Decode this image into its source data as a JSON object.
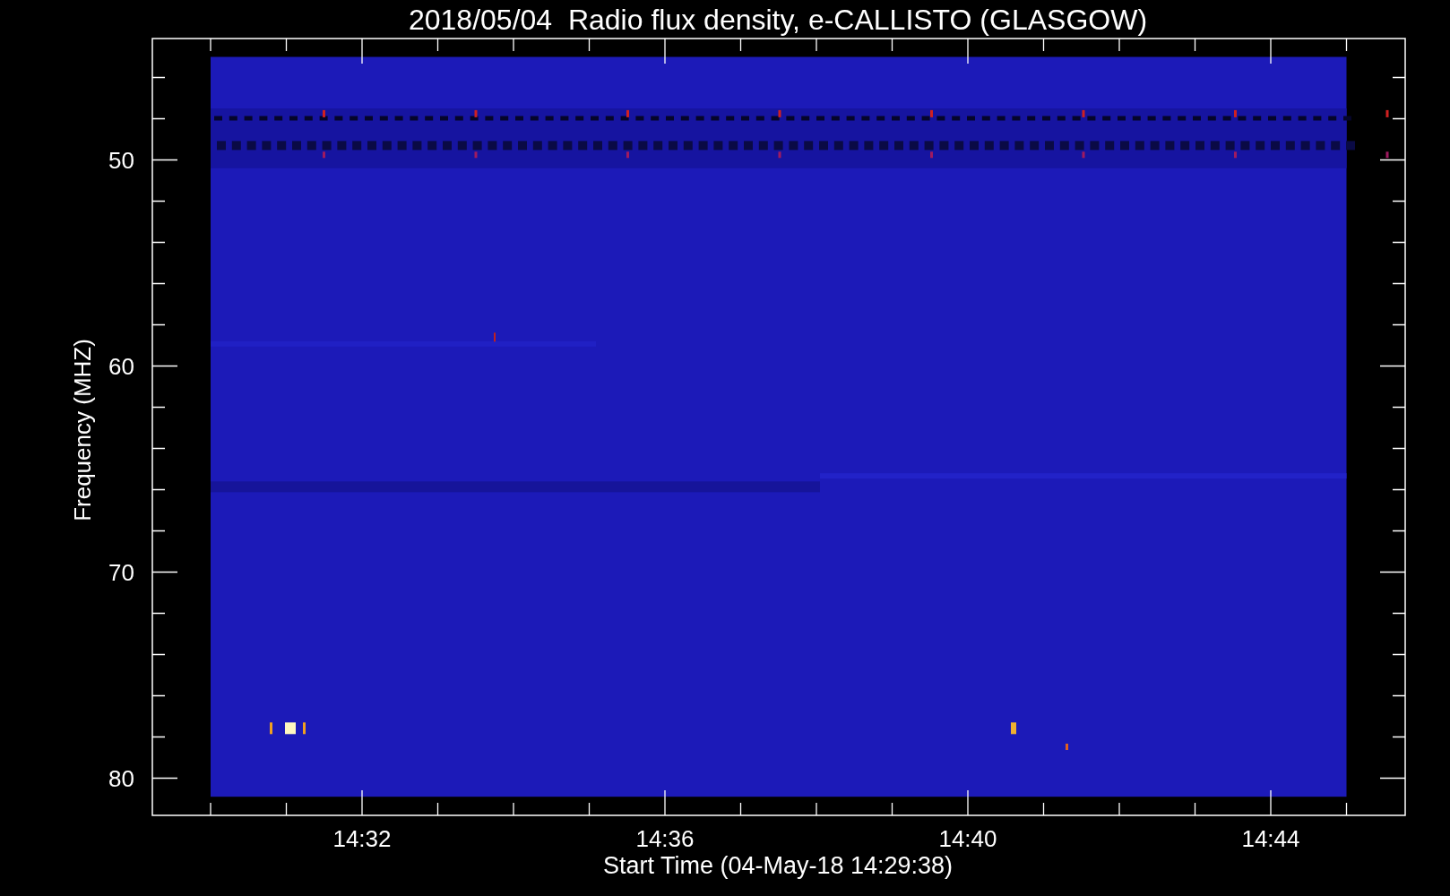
{
  "title": "2018/05/04  Radio flux density, e-CALLISTO (GLASGOW)",
  "y_axis": {
    "label": "Frequency (MHZ)",
    "ticks": [
      "50",
      "60",
      "70",
      "80"
    ]
  },
  "x_axis": {
    "label": "Start Time (04-May-18 14:29:38)",
    "ticks": [
      "14:32",
      "14:36",
      "14:40",
      "14:44"
    ]
  }
}
